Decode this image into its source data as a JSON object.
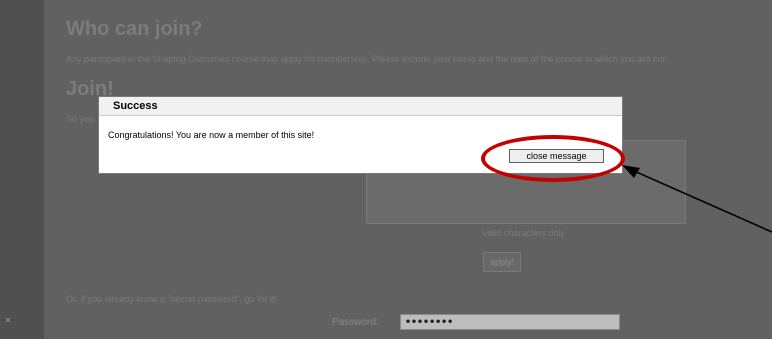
{
  "page": {
    "who_heading": "Who can join?",
    "who_text": "Any participant in the Shaping Outcomes course may apply for membership. Please include your name and the date of the course in which you are cur",
    "join_heading": "Join!",
    "join_text": "So you",
    "hint": "Valid characters only",
    "apply_label": "apply!",
    "secret_text": "Or, if you already know a \"secret password\", go for it!",
    "password_label": "Password:",
    "password_value": "••••••••"
  },
  "dialog": {
    "title": "Success",
    "message": "Congratulations! You are now a member of this site!",
    "close_label": "close message"
  },
  "annotation": {
    "highlight_color": "#c40000",
    "arrow_color": "#000000"
  }
}
